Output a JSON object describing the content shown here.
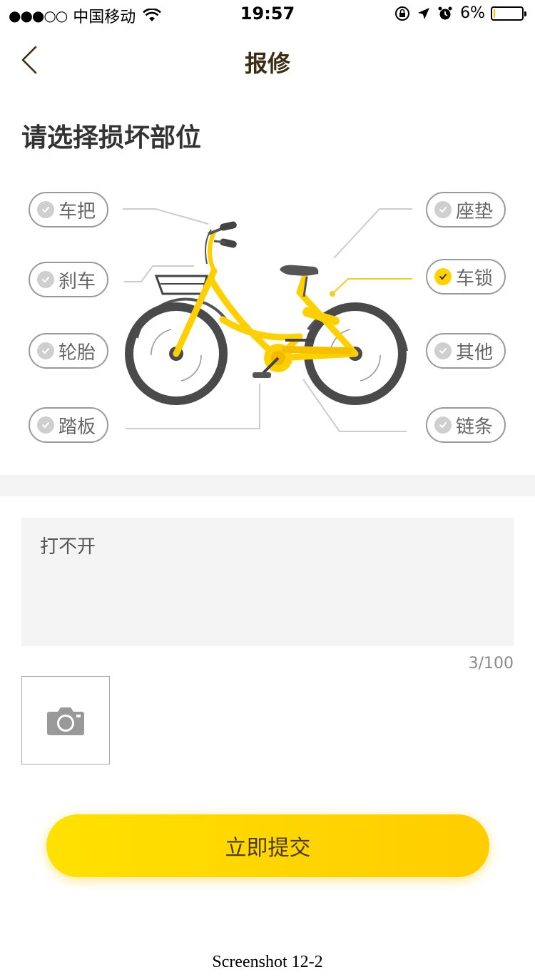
{
  "status_bar": {
    "signal": "●●●○○",
    "carrier": "中国移动",
    "time": "19:57",
    "battery_percent_label": "6%",
    "battery_level": 0.06,
    "icons": [
      "wifi-icon",
      "orientation-lock-icon",
      "location-arrow-icon",
      "alarm-icon",
      "battery-icon"
    ]
  },
  "nav": {
    "title": "报修",
    "back_icon": "chevron-left-icon"
  },
  "section_title": "请选择损坏部位",
  "parts": {
    "handlebar": {
      "label": "车把",
      "selected": false
    },
    "brake": {
      "label": "刹车",
      "selected": false
    },
    "tire": {
      "label": "轮胎",
      "selected": false
    },
    "pedal": {
      "label": "踏板",
      "selected": false
    },
    "seat": {
      "label": "座垫",
      "selected": false
    },
    "lock": {
      "label": "车锁",
      "selected": true
    },
    "other": {
      "label": "其他",
      "selected": false
    },
    "chain": {
      "label": "链条",
      "selected": false
    }
  },
  "description": {
    "value": "打不开",
    "counter": "3/100"
  },
  "photo": {
    "icon": "camera-icon"
  },
  "submit_label": "立即提交",
  "caption": "Screenshot 12-2",
  "colors": {
    "accent": "#ffd200",
    "title": "#3a2d12",
    "check_off": "#cfcfcf"
  }
}
